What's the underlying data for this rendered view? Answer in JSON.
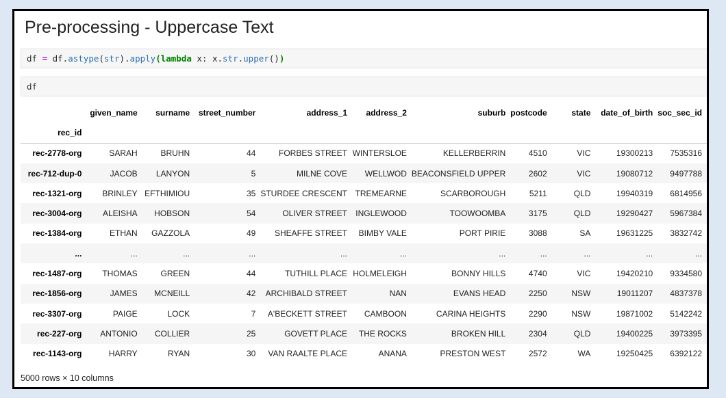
{
  "title": "Pre-processing - Uppercase Text",
  "cells": [
    {
      "tokens": [
        {
          "t": "df ",
          "c": "pn"
        },
        {
          "t": "=",
          "c": "op"
        },
        {
          "t": " df.",
          "c": "pn"
        },
        {
          "t": "astype",
          "c": "fn"
        },
        {
          "t": "(",
          "c": "pn"
        },
        {
          "t": "str",
          "c": "fn"
        },
        {
          "t": ").",
          "c": "pn"
        },
        {
          "t": "apply",
          "c": "fn"
        },
        {
          "t": "(",
          "c": "kw"
        },
        {
          "t": "lambda",
          "c": "kw"
        },
        {
          "t": " x: x.",
          "c": "pn"
        },
        {
          "t": "str",
          "c": "fn"
        },
        {
          "t": ".",
          "c": "pn"
        },
        {
          "t": "upper",
          "c": "fn"
        },
        {
          "t": "()",
          "c": "pn"
        },
        {
          "t": ")",
          "c": "kw"
        }
      ]
    },
    {
      "code": "df"
    }
  ],
  "table": {
    "index_name": "rec_id",
    "columns": [
      "given_name",
      "surname",
      "street_number",
      "address_1",
      "address_2",
      "suburb",
      "postcode",
      "state",
      "date_of_birth",
      "soc_sec_id"
    ],
    "rows": [
      [
        "rec-2778-org",
        "SARAH",
        "BRUHN",
        "44",
        "FORBES STREET",
        "WINTERSLOE",
        "KELLERBERRIN",
        "4510",
        "VIC",
        "19300213",
        "7535316"
      ],
      [
        "rec-712-dup-0",
        "JACOB",
        "LANYON",
        "5",
        "MILNE COVE",
        "WELLWOD",
        "BEACONSFIELD UPPER",
        "2602",
        "VIC",
        "19080712",
        "9497788"
      ],
      [
        "rec-1321-org",
        "BRINLEY",
        "EFTHIMIOU",
        "35",
        "STURDEE CRESCENT",
        "TREMEARNE",
        "SCARBOROUGH",
        "5211",
        "QLD",
        "19940319",
        "6814956"
      ],
      [
        "rec-3004-org",
        "ALEISHA",
        "HOBSON",
        "54",
        "OLIVER STREET",
        "INGLEWOOD",
        "TOOWOOMBA",
        "3175",
        "QLD",
        "19290427",
        "5967384"
      ],
      [
        "rec-1384-org",
        "ETHAN",
        "GAZZOLA",
        "49",
        "SHEAFFE STREET",
        "BIMBY VALE",
        "PORT PIRIE",
        "3088",
        "SA",
        "19631225",
        "3832742"
      ],
      [
        "...",
        "...",
        "...",
        "...",
        "...",
        "...",
        "...",
        "...",
        "...",
        "...",
        "..."
      ],
      [
        "rec-1487-org",
        "THOMAS",
        "GREEN",
        "44",
        "TUTHILL PLACE",
        "HOLMELEIGH",
        "BONNY HILLS",
        "4740",
        "VIC",
        "19420210",
        "9334580"
      ],
      [
        "rec-1856-org",
        "JAMES",
        "MCNEILL",
        "42",
        "ARCHIBALD STREET",
        "NAN",
        "EVANS HEAD",
        "2250",
        "NSW",
        "19011207",
        "4837378"
      ],
      [
        "rec-3307-org",
        "PAIGE",
        "LOCK",
        "7",
        "A'BECKETT STREET",
        "CAMBOON",
        "CARINA HEIGHTS",
        "2290",
        "NSW",
        "19871002",
        "5142242"
      ],
      [
        "rec-227-org",
        "ANTONIO",
        "COLLIER",
        "25",
        "GOVETT PLACE",
        "THE ROCKS",
        "BROKEN HILL",
        "2304",
        "QLD",
        "19400225",
        "3973395"
      ],
      [
        "rec-1143-org",
        "HARRY",
        "RYAN",
        "30",
        "VAN RAALTE PLACE",
        "ANANA",
        "PRESTON WEST",
        "2572",
        "WA",
        "19250425",
        "6392122"
      ]
    ]
  },
  "footer": "5000 rows × 10 columns"
}
